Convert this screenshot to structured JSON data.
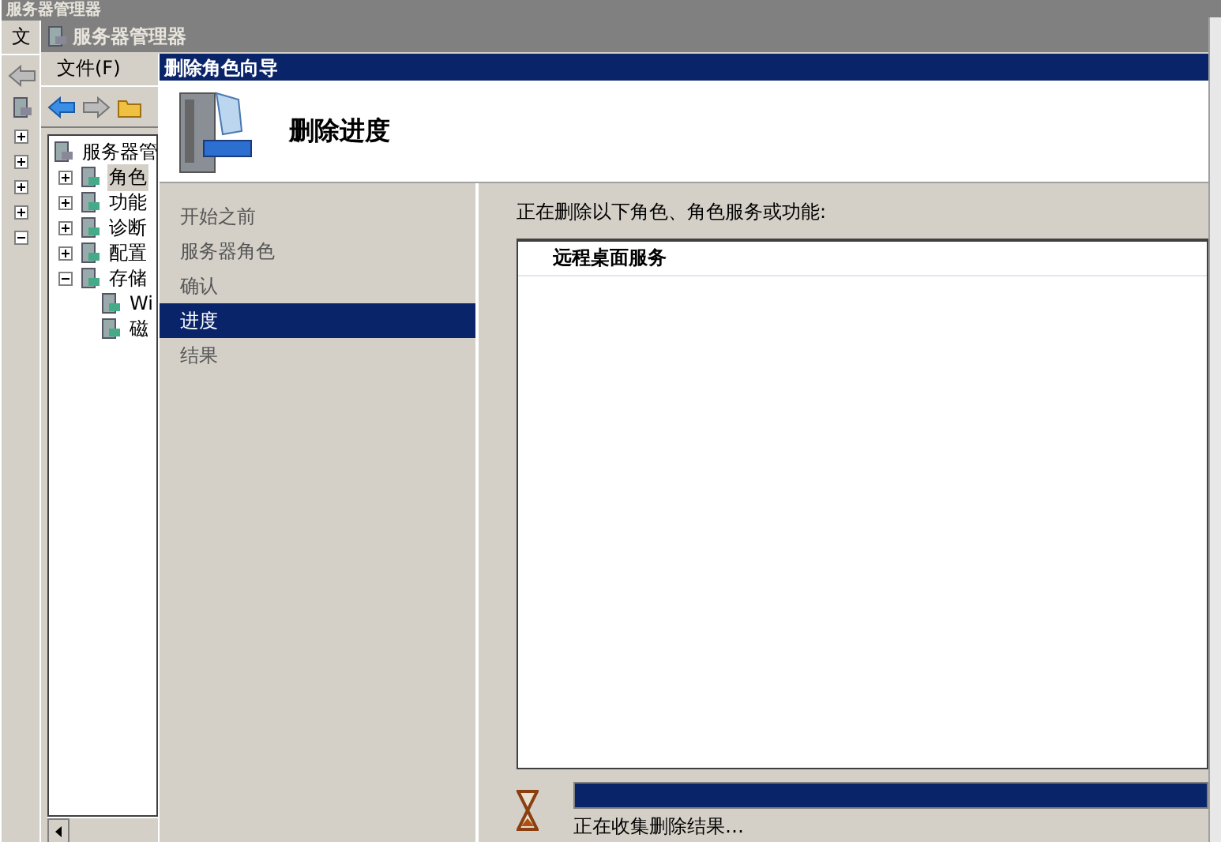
{
  "outer_window": {
    "title": "服务器管理器",
    "menu": [
      "文"
    ],
    "tree_toggles": [
      {
        "expanded": false
      },
      {
        "expanded": false
      },
      {
        "expanded": false
      },
      {
        "expanded": false
      },
      {
        "expanded": true
      }
    ]
  },
  "inner_window": {
    "title": "服务器管理器",
    "menu": [
      "文件(F)"
    ],
    "tree": {
      "label": "服务器管",
      "children": [
        {
          "label": "角色",
          "selected": true,
          "expanded": false
        },
        {
          "label": "功能",
          "selected": false,
          "expanded": false
        },
        {
          "label": "诊断",
          "selected": false,
          "expanded": false
        },
        {
          "label": "配置",
          "selected": false,
          "expanded": false
        },
        {
          "label": "存储",
          "selected": false,
          "expanded": true,
          "children": [
            {
              "label": "Wi",
              "selected": false
            },
            {
              "label": "磁",
              "selected": false
            }
          ]
        }
      ]
    }
  },
  "dialog": {
    "title": "删除角色向导",
    "heading": "删除进度",
    "steps": [
      {
        "label": "开始之前",
        "selected": false
      },
      {
        "label": "服务器角色",
        "selected": false
      },
      {
        "label": "确认",
        "selected": false
      },
      {
        "label": "进度",
        "selected": true
      },
      {
        "label": "结果",
        "selected": false
      }
    ],
    "prompt": "正在删除以下角色、角色服务或功能:",
    "items": [
      "远程桌面服务"
    ],
    "progress": {
      "level": 1
    },
    "status": "正在收集删除结果…"
  }
}
